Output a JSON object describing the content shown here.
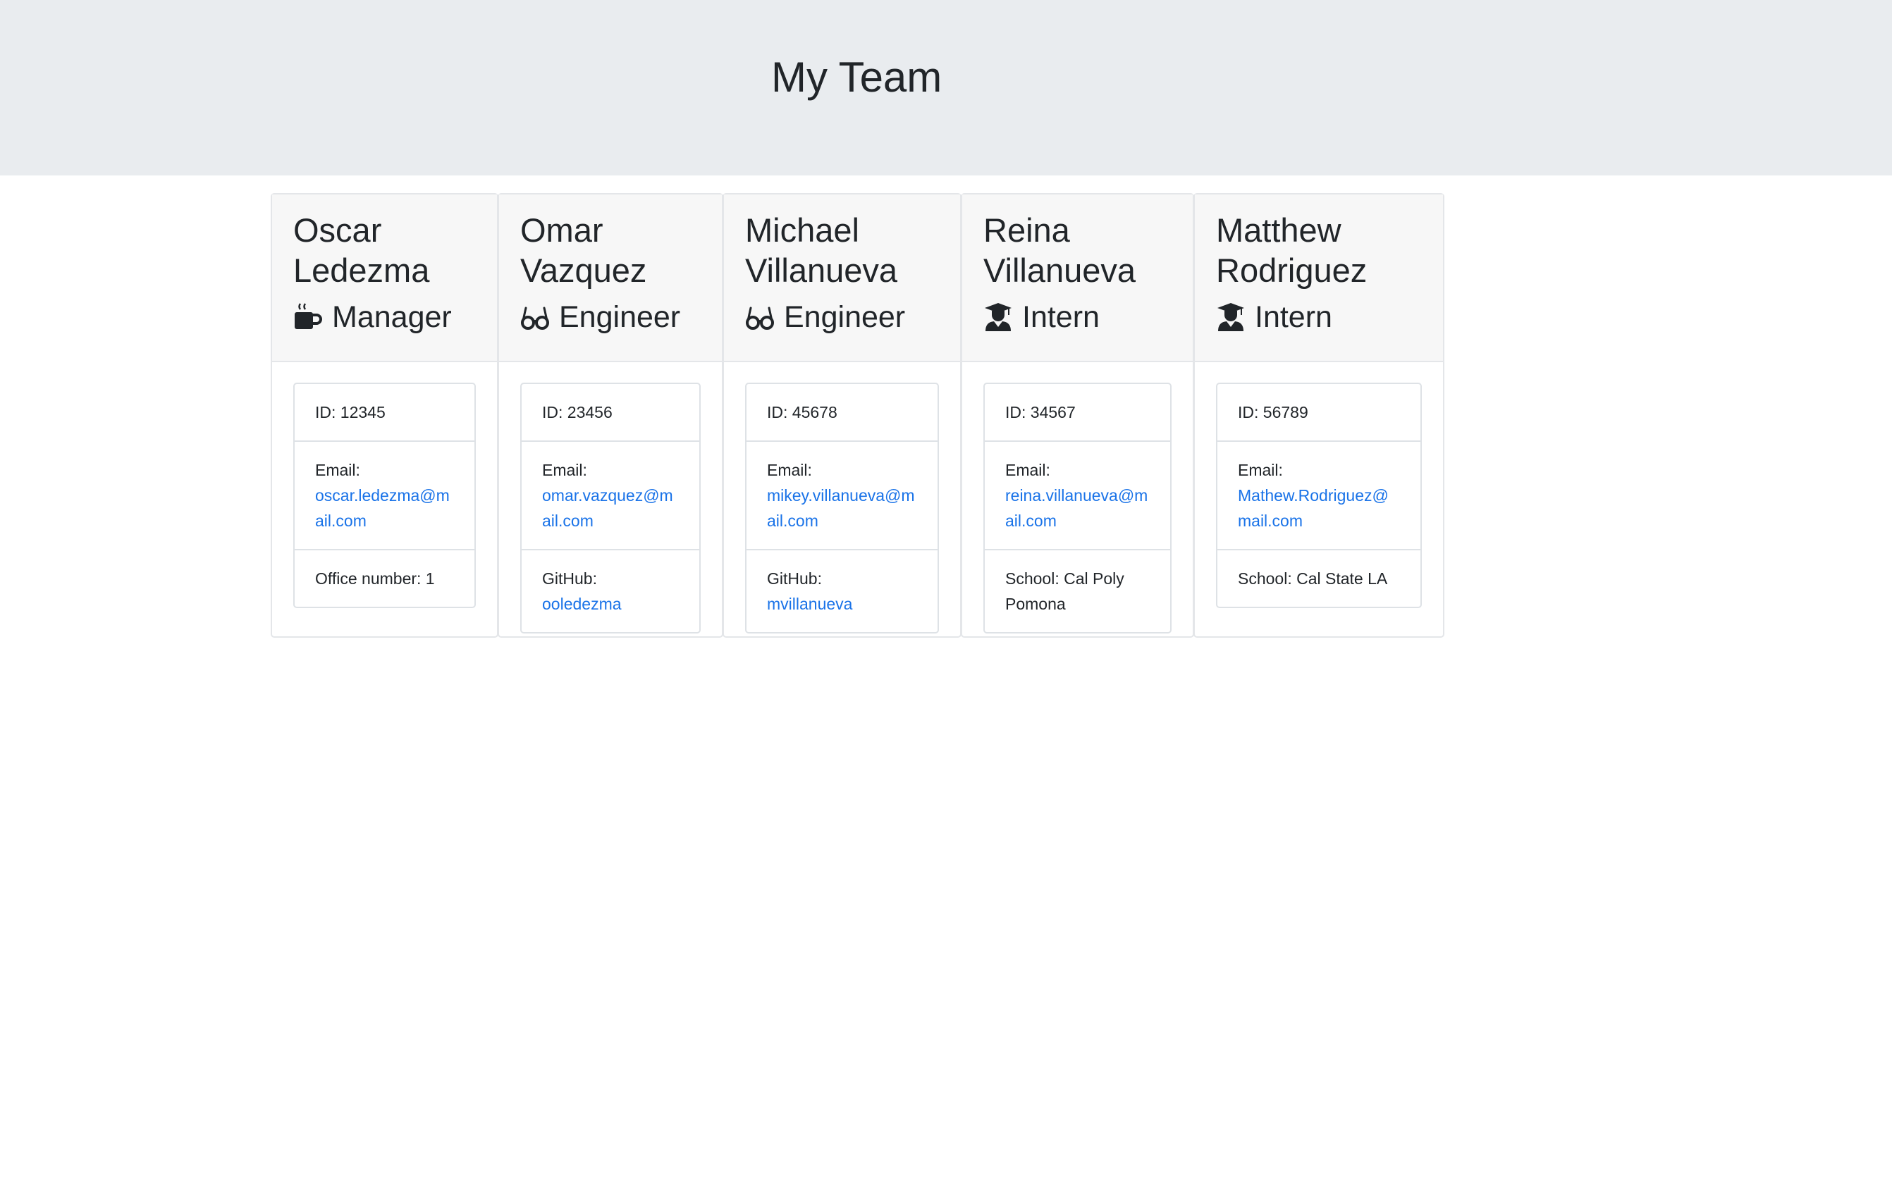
{
  "header": {
    "title": "My Team"
  },
  "icons": {
    "manager": "coffee-cup-icon",
    "engineer": "glasses-icon",
    "intern": "graduate-icon"
  },
  "colors": {
    "link": "#1a73e8",
    "header_bg": "#e9ecef",
    "card_header_bg": "#f7f7f7"
  },
  "employees": [
    {
      "first_name": "Oscar",
      "last_name": "Ledezma",
      "role": "Manager",
      "id_text": "ID: 12345",
      "email_label": "Email:",
      "email_link": "oscar.ledezma@mail.com",
      "extra_text": "Office number: 1"
    },
    {
      "first_name": "Omar",
      "last_name": "Vazquez",
      "role": "Engineer",
      "id_text": "ID: 23456",
      "email_label": "Email:",
      "email_link": "omar.vazquez@mail.com",
      "extra_label": "GitHub:",
      "extra_link": "ooledezma"
    },
    {
      "first_name": "Michael",
      "last_name": "Villanueva",
      "role": "Engineer",
      "id_text": "ID: 45678",
      "email_label": "Email:",
      "email_link": "mikey.villanueva@mail.com",
      "extra_label": "GitHub:",
      "extra_link": "mvillanueva"
    },
    {
      "first_name": "Reina",
      "last_name": "Villanueva",
      "role": "Intern",
      "id_text": "ID: 34567",
      "email_label": "Email:",
      "email_link": "reina.villanueva@mail.com",
      "extra_text": "School: Cal Poly Pomona"
    },
    {
      "first_name": "Matthew",
      "last_name": "Rodriguez",
      "role": "Intern",
      "id_text": "ID: 56789",
      "email_label": "Email:",
      "email_link": "Mathew.Rodriguez@mail.com",
      "extra_text": "School: Cal State LA"
    }
  ]
}
